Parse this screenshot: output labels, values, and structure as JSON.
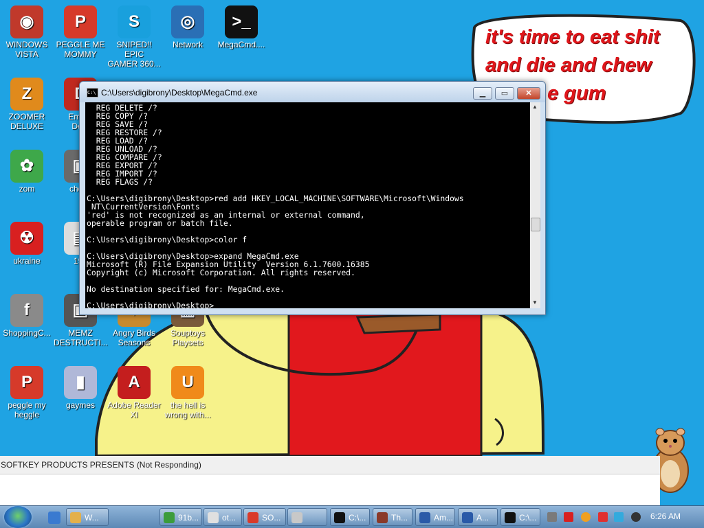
{
  "desktop": {
    "icons": [
      {
        "id": "windows-vista",
        "label1": "WINDOWS",
        "label2": "VISTA",
        "color": "#c0392b",
        "glyph": "◉"
      },
      {
        "id": "peggle-me-mommy",
        "label1": "PEGGLE ME",
        "label2": "MOMMY",
        "color": "#d63a2a",
        "glyph": "P"
      },
      {
        "id": "sniped",
        "label1": "SNIPED!! EPIC",
        "label2": "GAMER 360...",
        "color": "#19a0dd",
        "glyph": "S"
      },
      {
        "id": "network",
        "label1": "Network",
        "label2": "",
        "color": "#2a6fb5",
        "glyph": "◎"
      },
      {
        "id": "megacmd",
        "label1": "MegaCmd....",
        "label2": "",
        "color": "#111111",
        "glyph": ">_"
      },
      {
        "id": "zoomer-deluxe",
        "label1": "ZOOMER",
        "label2": "DELUXE",
        "color": "#e08a1c",
        "glyph": "Z"
      },
      {
        "id": "embarcadero",
        "label1": "Embar",
        "label2": "Dev-",
        "color": "#c0291f",
        "glyph": "D"
      },
      {
        "id": "zom",
        "label1": "zom",
        "label2": "",
        "color": "#3ea84a",
        "glyph": "✿"
      },
      {
        "id": "chomi",
        "label1": "chomi",
        "label2": "",
        "color": "#6a6a6a",
        "glyph": "▣"
      },
      {
        "id": "ukraine",
        "label1": "ukraine",
        "label2": "",
        "color": "#d82020",
        "glyph": "☢"
      },
      {
        "id": "doc-198",
        "label1": "198",
        "label2": "",
        "color": "#dddddd",
        "glyph": "▤"
      },
      {
        "id": "shopping",
        "label1": "ShoppingC...",
        "label2": "",
        "color": "#8a8a8a",
        "glyph": "f"
      },
      {
        "id": "memz",
        "label1": "MEMZ",
        "label2": "DESTRUCTI...",
        "color": "#555555",
        "glyph": "▣"
      },
      {
        "id": "angry-birds",
        "label1": "Angry Birds",
        "label2": "Seasons",
        "color": "#c88a2e",
        "glyph": "✦"
      },
      {
        "id": "souptoys",
        "label1": "Souptoys",
        "label2": "Playsets",
        "color": "#7a5a3a",
        "glyph": "▦"
      },
      {
        "id": "peggle-my-heggle",
        "label1": "peggle my",
        "label2": "heggle",
        "color": "#d63a2a",
        "glyph": "P"
      },
      {
        "id": "gaymes",
        "label1": "gaymes",
        "label2": "",
        "color": "#b0b8d8",
        "glyph": "▮"
      },
      {
        "id": "adobe-reader",
        "label1": "Adobe Reader",
        "label2": "XI",
        "color": "#c41e1e",
        "glyph": "A"
      },
      {
        "id": "the-hell-is",
        "label1": "the hell is",
        "label2": "wrong with...",
        "color": "#f08a1a",
        "glyph": "U"
      }
    ],
    "speech": {
      "line1": "it's time to eat shit",
      "line2": "and die and chew",
      "line3": "e gum"
    }
  },
  "console": {
    "title": "C:\\Users\\digibrony\\Desktop\\MegaCmd.exe",
    "icon_text": "C:\\",
    "buttons": {
      "minimize": "▁",
      "maximize": "▭",
      "close": "✕"
    },
    "lines": [
      "  REG DELETE /?",
      "  REG COPY /?",
      "  REG SAVE /?",
      "  REG RESTORE /?",
      "  REG LOAD /?",
      "  REG UNLOAD /?",
      "  REG COMPARE /?",
      "  REG EXPORT /?",
      "  REG IMPORT /?",
      "  REG FLAGS /?",
      "",
      "C:\\Users\\digibrony\\Desktop>red add HKEY_LOCAL_MACHINE\\SOFTWARE\\Microsoft\\Windows",
      " NT\\CurrentVersion\\Fonts",
      "'red' is not recognized as an internal or external command,",
      "operable program or batch file.",
      "",
      "C:\\Users\\digibrony\\Desktop>color f",
      "",
      "C:\\Users\\digibrony\\Desktop>expand MegaCmd.exe",
      "Microsoft (R) File Expansion Utility  Version 6.1.7600.16385",
      "Copyright (c) Microsoft Corporation. All rights reserved.",
      "",
      "No destination specified for: MegaCmd.exe.",
      "",
      "C:\\Users\\digibrony\\Desktop>"
    ]
  },
  "not_responding": {
    "title": "SOFTKEY PRODUCTS PRESENTS (Not Responding)"
  },
  "taskbar": {
    "buttons": [
      {
        "id": "explorer",
        "label": "W...",
        "color": "#e3b04b"
      },
      {
        "id": "chrome",
        "label": "91b...",
        "color": "#3c9c3c"
      },
      {
        "id": "other",
        "label": "ot...",
        "color": "#e0e0e0"
      },
      {
        "id": "softkey",
        "label": "SO...",
        "color": "#d93a2a"
      },
      {
        "id": "printer",
        "label": "",
        "color": "#c8c8c8"
      },
      {
        "id": "cmd1",
        "label": "C:\\...",
        "color": "#111111"
      },
      {
        "id": "th",
        "label": "Th...",
        "color": "#8a3a2a"
      },
      {
        "id": "am",
        "label": "Am...",
        "color": "#2a5aa8"
      },
      {
        "id": "a",
        "label": "A...",
        "color": "#2a5aa8"
      },
      {
        "id": "cmd2",
        "label": "C:\\...",
        "color": "#111111"
      }
    ],
    "clock": "6:26 AM"
  }
}
